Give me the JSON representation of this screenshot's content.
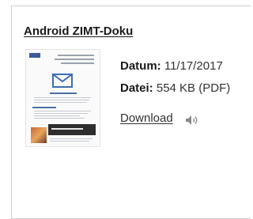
{
  "card": {
    "title": "Android ZIMT-Doku",
    "date_label": "Datum:",
    "date_value": "11/17/2017",
    "file_label": "Datei:",
    "file_value": "554 KB (PDF)",
    "download_label": "Download"
  },
  "icons": {
    "preview": "pdf-preview-thumbnail",
    "speaker": "speaker-icon"
  },
  "colors": {
    "border": "#cfcfcf",
    "text": "#1a1a1a",
    "accent": "#3b5b9a"
  }
}
